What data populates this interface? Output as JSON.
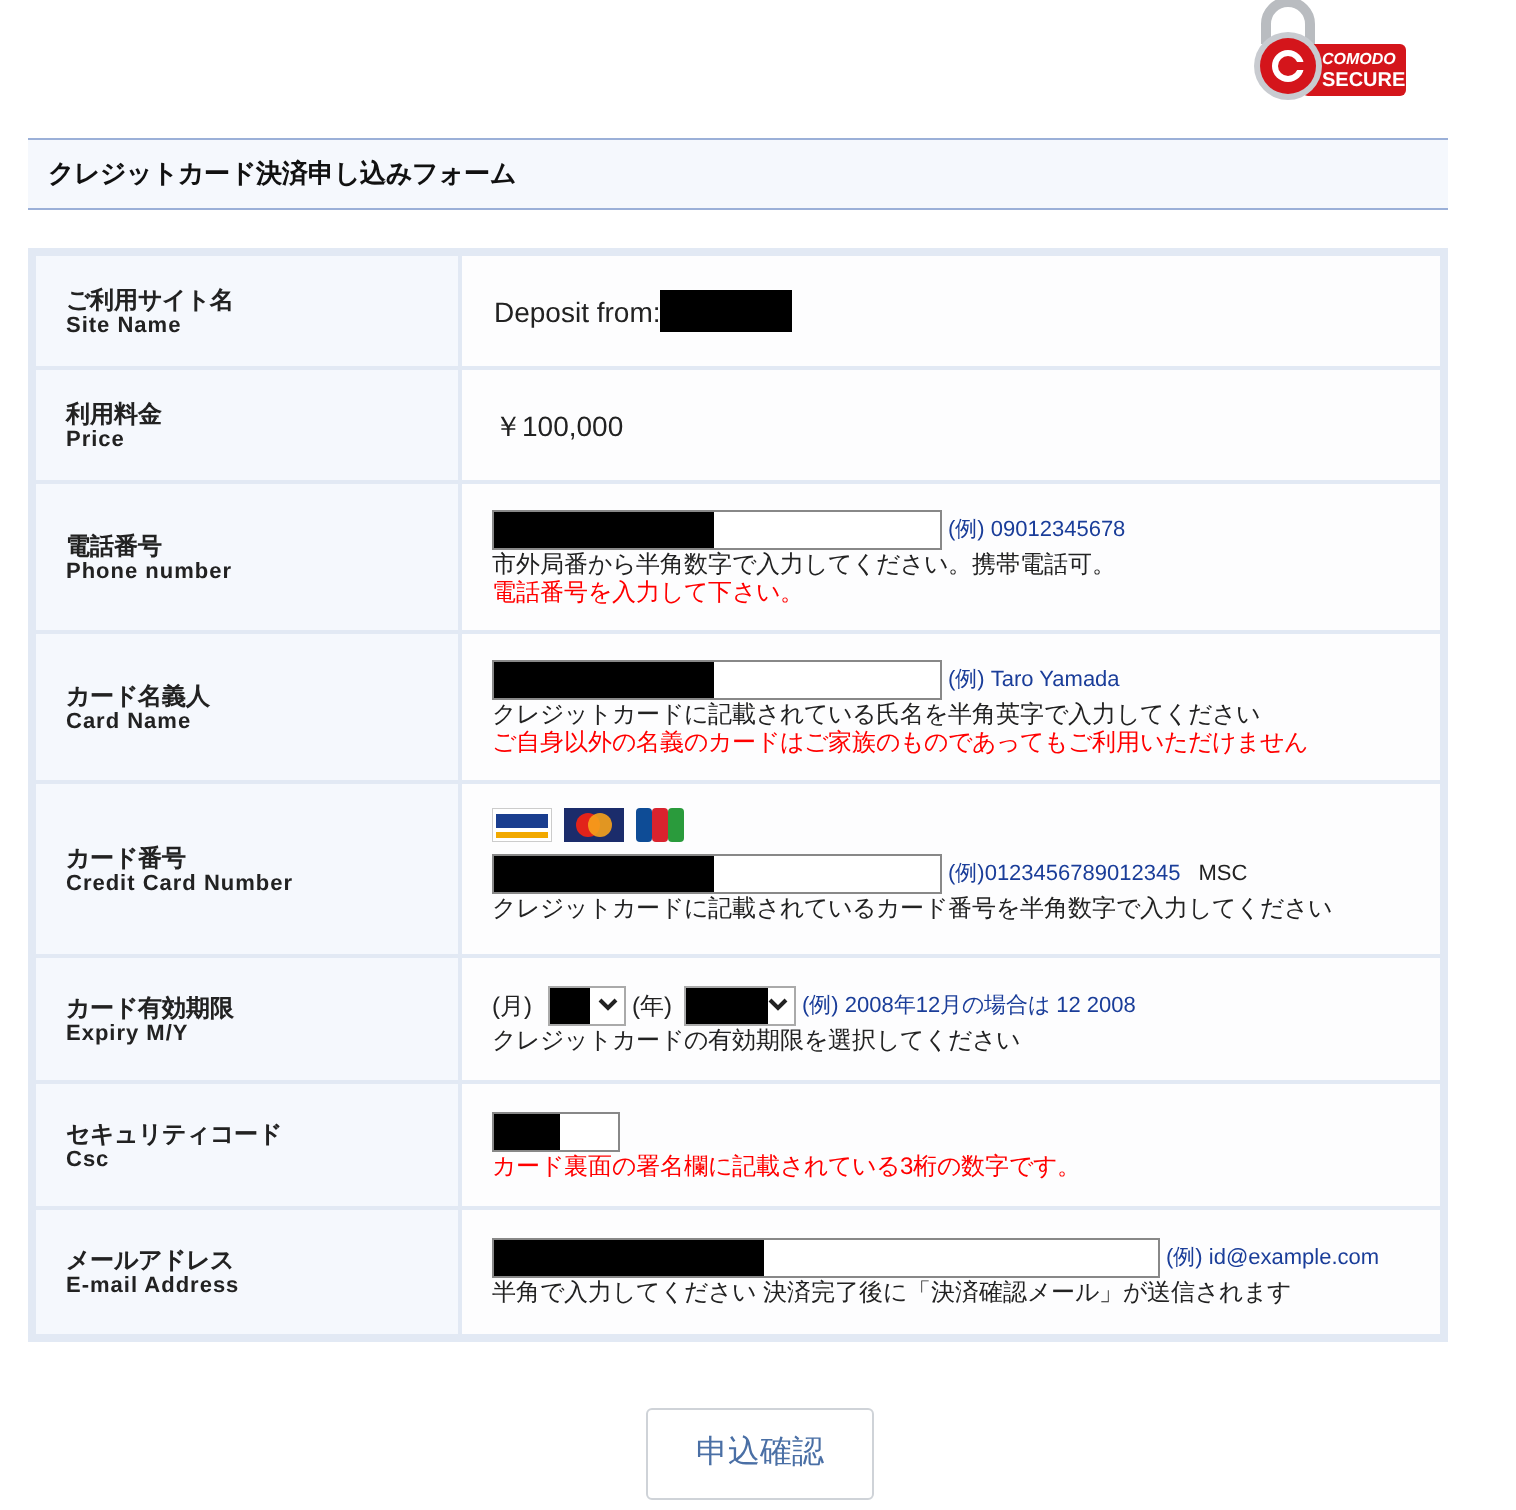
{
  "logo": {
    "line1": "COMODO",
    "line2": "SECURE"
  },
  "form_title": "クレジットカード決済申し込みフォーム",
  "rows": [
    {
      "kind": "static",
      "label_ja": "ご利用サイト名",
      "label_en": "Site Name",
      "value": "Deposit from:",
      "redacted": true
    },
    {
      "kind": "static",
      "label_ja": "利用料金",
      "label_en": "Price",
      "value": "￥100,000"
    },
    {
      "kind": "input",
      "label_ja": "電話番号",
      "label_en": "Phone number",
      "redacted": true,
      "example": "(例) 09012345678",
      "notes": [
        {
          "text": "市外局番から半角数字で入力してください。携帯電話可。",
          "color": "#222222"
        },
        {
          "text": "電話番号を入力して下さい。",
          "color": "#ff0000"
        }
      ]
    },
    {
      "kind": "input",
      "label_ja": "カード名義人",
      "label_en": "Card Name",
      "redacted": true,
      "example": "(例) Taro Yamada",
      "notes": [
        {
          "text": "クレジットカードに記載されている氏名を半角英字で入力してください",
          "color": "#222222"
        },
        {
          "text": "ご自身以外の名義のカードはご家族のものであってもご利用いただけません",
          "color": "#ff0000"
        }
      ]
    },
    {
      "kind": "card",
      "label_ja": "カード番号",
      "label_en": "Credit Card Number",
      "redacted": true,
      "example": "(例)0123456789012345",
      "suffix": "MSC",
      "notes": [
        {
          "text": "クレジットカードに記載されているカード番号を半角数字で入力してください",
          "color": "#222222"
        }
      ]
    },
    {
      "kind": "expiry",
      "label_ja": "カード有効期限",
      "label_en": "Expiry M/Y",
      "month_label": "(月)",
      "year_label": "(年)",
      "redacted": true,
      "example": "(例) 2008年12月の場合は 12 2008",
      "notes": [
        {
          "text": "クレジットカードの有効期限を選択してください",
          "color": "#222222"
        }
      ]
    },
    {
      "kind": "code",
      "label_ja": "セキュリティコード",
      "label_en": "Csc",
      "redacted": true,
      "notes": [
        {
          "text": "カード裏面の署名欄に記載されている3桁の数字です。",
          "color": "#ff0000"
        }
      ]
    },
    {
      "kind": "email",
      "label_ja": "メールアドレス",
      "label_en": "E-mail Address",
      "redacted": true,
      "example": "(例) id@example.com",
      "notes": [
        {
          "text": "半角で入力してください 決済完了後に「決済確認メール」が送信されます",
          "color": "#222222"
        }
      ]
    }
  ],
  "submit_button": "申込確認"
}
